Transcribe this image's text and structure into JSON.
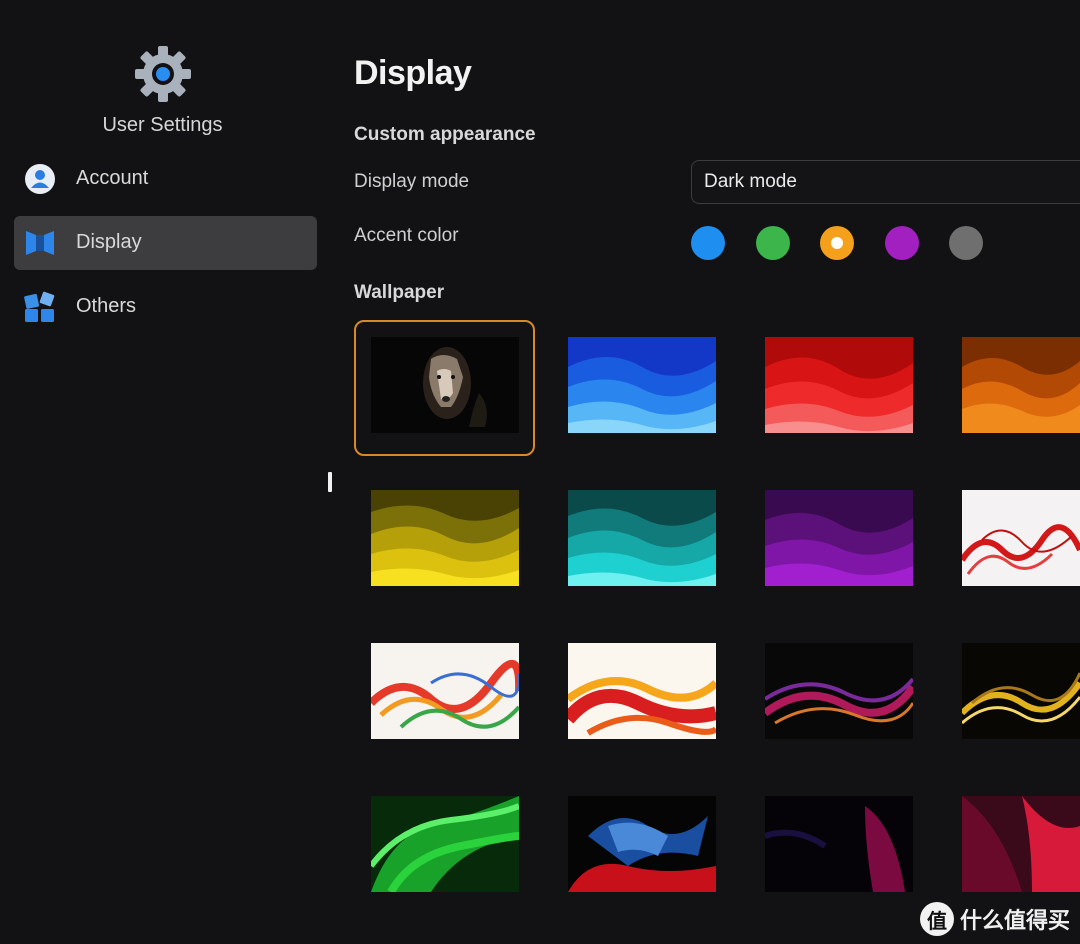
{
  "sidebar": {
    "title": "User Settings",
    "items": [
      {
        "label": "Account",
        "icon": "user-icon",
        "active": false
      },
      {
        "label": "Display",
        "icon": "display-icon",
        "active": true
      },
      {
        "label": "Others",
        "icon": "apps-icon",
        "active": false
      }
    ]
  },
  "main": {
    "title": "Display",
    "custom_appearance_heading": "Custom appearance",
    "display_mode_label": "Display mode",
    "display_mode_value": "Dark mode",
    "accent_color_label": "Accent color",
    "accent_colors": [
      "#1f8ef1",
      "#3cb54a",
      "#f5a01a",
      "#a21fc0",
      "#6f6f6f"
    ],
    "selected_accent_index": 2,
    "wallpaper_heading": "Wallpaper",
    "selected_wallpaper_index": 0
  },
  "watermark": {
    "badge": "值",
    "text": "什么值得买"
  }
}
